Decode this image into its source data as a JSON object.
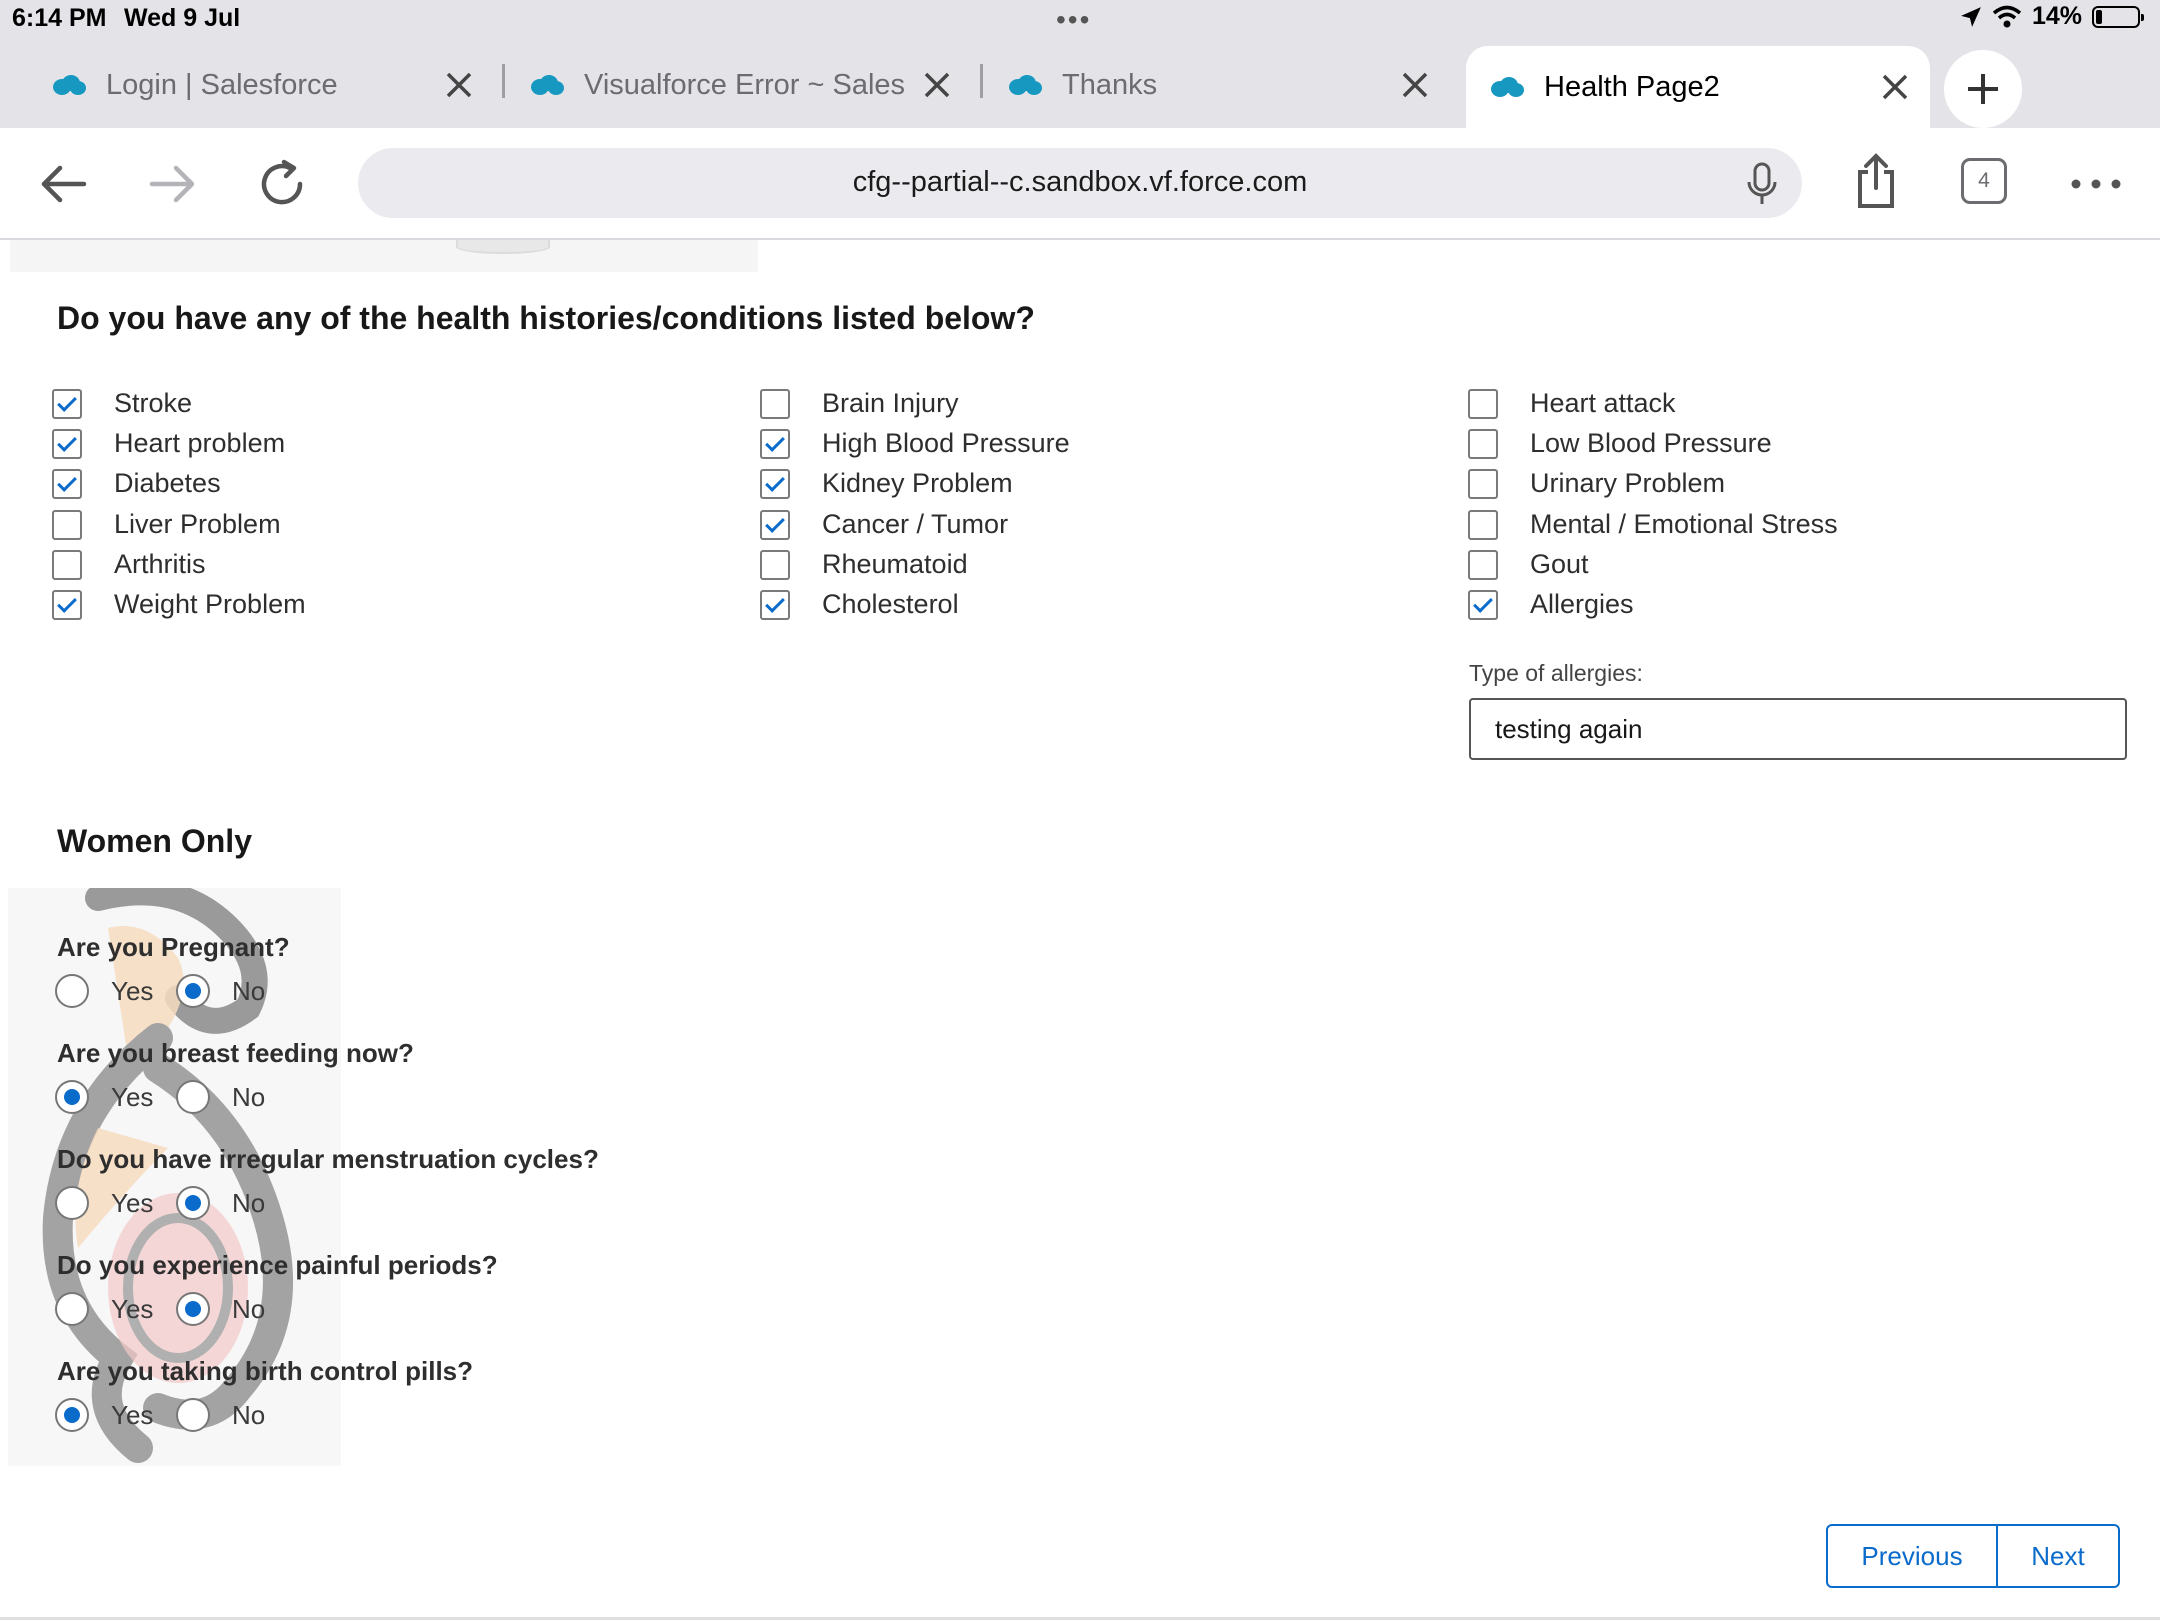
{
  "status_bar": {
    "time": "6:14 PM",
    "date": "Wed 9 Jul",
    "battery": "14%",
    "battery_level": 0.14
  },
  "tabs": [
    {
      "label": "Login | Salesforce",
      "active": false
    },
    {
      "label": "Visualforce Error ~ Sales",
      "active": false
    },
    {
      "label": "Thanks",
      "active": false
    },
    {
      "label": "Health Page2",
      "active": true
    }
  ],
  "toolbar": {
    "url": "cfg--partial--c.sandbox.vf.force.com",
    "tab_count": "4"
  },
  "form": {
    "question": "Do you have any of the health histories/conditions listed below?",
    "conditions": [
      {
        "label": "Stroke",
        "checked": true
      },
      {
        "label": "Heart problem",
        "checked": true
      },
      {
        "label": "Diabetes",
        "checked": true
      },
      {
        "label": "Liver Problem",
        "checked": false
      },
      {
        "label": "Arthritis",
        "checked": false
      },
      {
        "label": "Weight Problem",
        "checked": true
      },
      {
        "label": "Brain Injury",
        "checked": false
      },
      {
        "label": "High Blood Pressure",
        "checked": true
      },
      {
        "label": "Kidney Problem",
        "checked": true
      },
      {
        "label": "Cancer / Tumor",
        "checked": true
      },
      {
        "label": "Rheumatoid",
        "checked": false
      },
      {
        "label": "Cholesterol",
        "checked": true
      },
      {
        "label": "Heart attack",
        "checked": false
      },
      {
        "label": "Low Blood Pressure",
        "checked": false
      },
      {
        "label": "Urinary Problem",
        "checked": false
      },
      {
        "label": "Mental / Emotional Stress",
        "checked": false
      },
      {
        "label": "Gout",
        "checked": false
      },
      {
        "label": "Allergies",
        "checked": true
      }
    ],
    "allergies_label": "Type of allergies:",
    "allergies_value": "testing again"
  },
  "women": {
    "title": "Women Only",
    "yes_label": "Yes",
    "no_label": "No",
    "questions": [
      {
        "label": "Are you Pregnant?",
        "answer": "No"
      },
      {
        "label": "Are you breast feeding now?",
        "answer": "Yes"
      },
      {
        "label": "Do you have irregular menstruation cycles?",
        "answer": "No"
      },
      {
        "label": "Do you experience painful periods?",
        "answer": "No"
      },
      {
        "label": "Are you taking birth control pills?",
        "answer": "Yes"
      }
    ]
  },
  "nav": {
    "previous": "Previous",
    "next": "Next"
  },
  "colors": {
    "accent": "#0b6bcb",
    "salesforce_cloud": "#1798c1"
  }
}
